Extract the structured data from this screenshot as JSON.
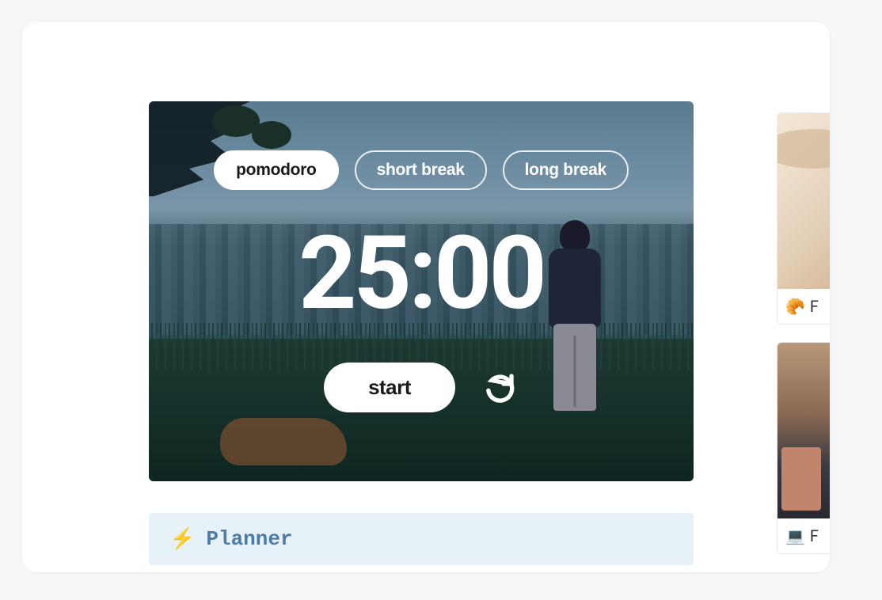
{
  "timer": {
    "modes": [
      {
        "label": "pomodoro",
        "active": true
      },
      {
        "label": "short break",
        "active": false
      },
      {
        "label": "long break",
        "active": false
      }
    ],
    "display": "25:00",
    "start_label": "start"
  },
  "planner": {
    "icon": "⚡",
    "title": "Planner"
  },
  "sidebar": {
    "cards": [
      {
        "icon": "🥐",
        "label": "F"
      },
      {
        "icon": "💻",
        "label": "F"
      }
    ]
  }
}
